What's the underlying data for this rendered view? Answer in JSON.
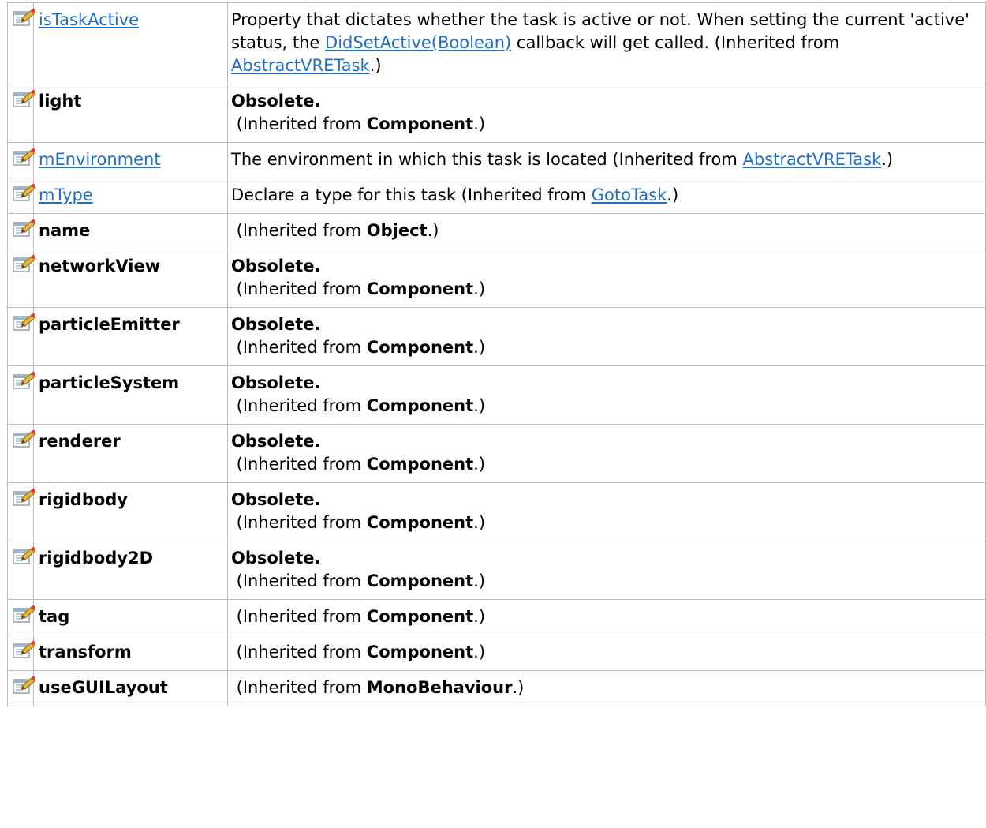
{
  "members": [
    {
      "name": "isTaskActive",
      "name_is_link": true,
      "desc_parts": [
        {
          "text": "Property that dictates whether the task is active or not. When setting the current 'active' status, the ",
          "style": "plain"
        },
        {
          "text": "DidSetActive(Boolean)",
          "style": "link"
        },
        {
          "text": " callback will get called. (Inherited from ",
          "style": "plain"
        },
        {
          "text": "AbstractVRETask",
          "style": "link"
        },
        {
          "text": ".)",
          "style": "plain"
        }
      ]
    },
    {
      "name": "light",
      "name_is_link": false,
      "obsolete_label": "Obsolete.",
      "inherited_prefix": " (Inherited from ",
      "inherited_class": "Component",
      "inherited_suffix": ".)"
    },
    {
      "name": "mEnvironment",
      "name_is_link": true,
      "desc_parts": [
        {
          "text": "The environment in which this task is located (Inherited from ",
          "style": "plain"
        },
        {
          "text": "AbstractVRETask",
          "style": "link"
        },
        {
          "text": ".)",
          "style": "plain"
        }
      ]
    },
    {
      "name": "mType",
      "name_is_link": true,
      "desc_parts": [
        {
          "text": "Declare a type for this task (Inherited from ",
          "style": "plain"
        },
        {
          "text": "GotoTask",
          "style": "link"
        },
        {
          "text": ".)",
          "style": "plain"
        }
      ]
    },
    {
      "name": "name",
      "name_is_link": false,
      "inherited_prefix": " (Inherited from ",
      "inherited_class": "Object",
      "inherited_suffix": ".)"
    },
    {
      "name": "networkView",
      "name_is_link": false,
      "obsolete_label": "Obsolete.",
      "inherited_prefix": " (Inherited from ",
      "inherited_class": "Component",
      "inherited_suffix": ".)"
    },
    {
      "name": "particleEmitter",
      "name_is_link": false,
      "obsolete_label": "Obsolete.",
      "inherited_prefix": " (Inherited from ",
      "inherited_class": "Component",
      "inherited_suffix": ".)"
    },
    {
      "name": "particleSystem",
      "name_is_link": false,
      "obsolete_label": "Obsolete.",
      "inherited_prefix": " (Inherited from ",
      "inherited_class": "Component",
      "inherited_suffix": ".)"
    },
    {
      "name": "renderer",
      "name_is_link": false,
      "obsolete_label": "Obsolete.",
      "inherited_prefix": " (Inherited from ",
      "inherited_class": "Component",
      "inherited_suffix": ".)"
    },
    {
      "name": "rigidbody",
      "name_is_link": false,
      "obsolete_label": "Obsolete.",
      "inherited_prefix": " (Inherited from ",
      "inherited_class": "Component",
      "inherited_suffix": ".)"
    },
    {
      "name": "rigidbody2D",
      "name_is_link": false,
      "obsolete_label": "Obsolete.",
      "inherited_prefix": " (Inherited from ",
      "inherited_class": "Component",
      "inherited_suffix": ".)"
    },
    {
      "name": "tag",
      "name_is_link": false,
      "inherited_prefix": " (Inherited from ",
      "inherited_class": "Component",
      "inherited_suffix": ".)"
    },
    {
      "name": "transform",
      "name_is_link": false,
      "inherited_prefix": " (Inherited from ",
      "inherited_class": "Component",
      "inherited_suffix": ".)"
    },
    {
      "name": "useGUILayout",
      "name_is_link": false,
      "inherited_prefix": " (Inherited from ",
      "inherited_class": "MonoBehaviour",
      "inherited_suffix": ".)"
    }
  ],
  "icon": "public-property-icon",
  "colors": {
    "link": "#1f6fc5",
    "border": "#bdbdbd",
    "text": "#000000"
  }
}
